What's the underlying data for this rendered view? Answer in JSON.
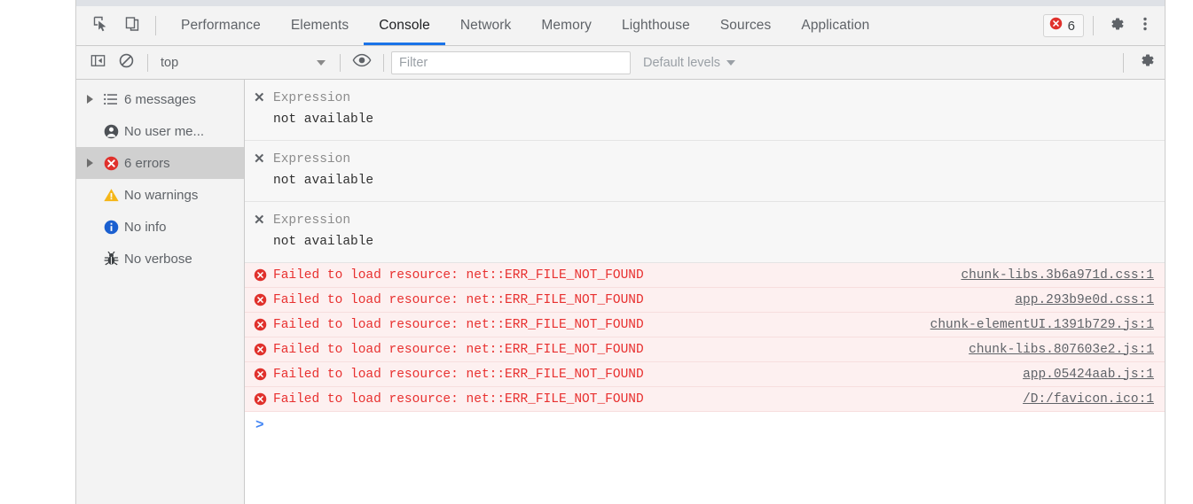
{
  "tabbar": {
    "inspect_icon": "inspect-cursor-icon",
    "device_icon": "device-toolbar-icon",
    "tabs": [
      {
        "label": "Performance",
        "active": false
      },
      {
        "label": "Elements",
        "active": false
      },
      {
        "label": "Console",
        "active": true
      },
      {
        "label": "Network",
        "active": false
      },
      {
        "label": "Memory",
        "active": false
      },
      {
        "label": "Lighthouse",
        "active": false
      },
      {
        "label": "Sources",
        "active": false
      },
      {
        "label": "Application",
        "active": false
      }
    ],
    "error_badge": {
      "icon": "error-circle-icon",
      "count": "6"
    },
    "settings_icon": "gear-icon",
    "more_icon": "more-vertical-icon"
  },
  "toolbar": {
    "sidebar_toggle_icon": "show-console-sidebar-icon",
    "clear_icon": "clear-console-icon",
    "context_value": "top",
    "eye_icon": "live-expression-eye-icon",
    "filter_placeholder": "Filter",
    "filter_value": "",
    "levels_label": "Default levels",
    "settings_icon": "gear-icon"
  },
  "sidebar": {
    "items": [
      {
        "label": "6 messages",
        "icon": "list-icon",
        "arrow": true,
        "selected": false
      },
      {
        "label": "No user me...",
        "icon": "user-circle-icon",
        "arrow": false,
        "selected": false
      },
      {
        "label": "6 errors",
        "icon": "error-circle-icon",
        "arrow": true,
        "selected": true
      },
      {
        "label": "No warnings",
        "icon": "warning-triangle-icon",
        "arrow": false,
        "selected": false
      },
      {
        "label": "No info",
        "icon": "info-circle-icon",
        "arrow": false,
        "selected": false
      },
      {
        "label": "No verbose",
        "icon": "bug-icon",
        "arrow": false,
        "selected": false
      }
    ]
  },
  "messages": {
    "expressions": [
      {
        "title": "Expression",
        "value": "not available"
      },
      {
        "title": "Expression",
        "value": "not available"
      },
      {
        "title": "Expression",
        "value": "not available"
      }
    ],
    "errors": [
      {
        "text": "Failed to load resource: net::ERR_FILE_NOT_FOUND",
        "link": "chunk-libs.3b6a971d.css:1"
      },
      {
        "text": "Failed to load resource: net::ERR_FILE_NOT_FOUND",
        "link": "app.293b9e0d.css:1"
      },
      {
        "text": "Failed to load resource: net::ERR_FILE_NOT_FOUND",
        "link": "chunk-elementUI.1391b729.js:1"
      },
      {
        "text": "Failed to load resource: net::ERR_FILE_NOT_FOUND",
        "link": "chunk-libs.807603e2.js:1"
      },
      {
        "text": "Failed to load resource: net::ERR_FILE_NOT_FOUND",
        "link": "app.05424aab.js:1"
      },
      {
        "text": "Failed to load resource: net::ERR_FILE_NOT_FOUND",
        "link": "/D:/favicon.ico:1"
      }
    ],
    "prompt_chevron": ">",
    "prompt_value": ""
  },
  "colors": {
    "accent": "#1a73e8",
    "error_red": "#e8302f",
    "error_bg": "#fdf0f0",
    "warning_yellow": "#f5a623",
    "info_blue": "#1a73e8",
    "panel_bg": "#f3f3f3",
    "selected_bg": "#d0d0d0"
  }
}
